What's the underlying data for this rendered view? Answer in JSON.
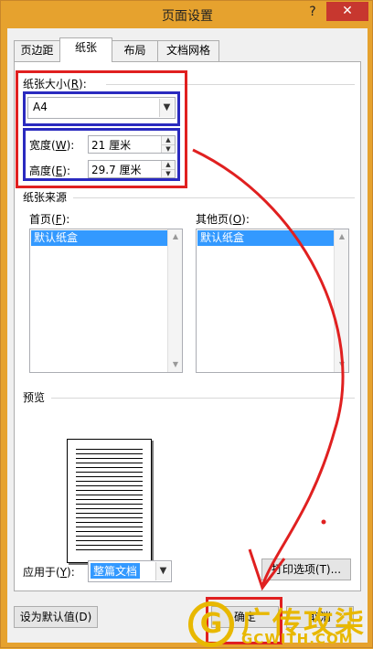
{
  "window": {
    "title": "页面设置",
    "help": "?",
    "close": "✕"
  },
  "tabs": [
    {
      "label": "页边距",
      "active": false
    },
    {
      "label": "纸张",
      "active": true
    },
    {
      "label": "布局",
      "active": false
    },
    {
      "label": "文档网格",
      "active": false
    }
  ],
  "paper_size": {
    "group_label": "纸张大小(",
    "group_key": "R",
    "group_tail": "):",
    "value": "A4"
  },
  "width": {
    "label": "宽度(",
    "key": "W",
    "tail": "):",
    "value": "21 厘米"
  },
  "height": {
    "label": "高度(",
    "key": "E",
    "tail": "):",
    "value": "29.7 厘米"
  },
  "paper_source": {
    "group_label": "纸张来源",
    "first_page": {
      "label": "首页(",
      "key": "F",
      "tail": "):",
      "selected": "默认纸盒"
    },
    "other_pages": {
      "label": "其他页(",
      "key": "O",
      "tail": "):",
      "selected": "默认纸盒"
    }
  },
  "preview": {
    "label": "预览"
  },
  "apply_to": {
    "label": "应用于(",
    "key": "Y",
    "tail": "):",
    "value": "整篇文档"
  },
  "buttons": {
    "print_options": "打印选项(T)...",
    "set_default": "设为默认值(D)",
    "ok": "确定",
    "cancel": "取消"
  },
  "watermark": {
    "cn": "广传攻柒",
    "en": "GCWITH.COM",
    "logo": "G"
  },
  "icons": {
    "dropdown": "chevron-down-icon",
    "spin_up": "spin-up-icon",
    "spin_down": "spin-down-icon"
  },
  "colors": {
    "annotation_red": "#e02020",
    "annotation_blue": "#2a2abf",
    "selection": "#3399ff",
    "titlebar": "#e6a22e"
  }
}
